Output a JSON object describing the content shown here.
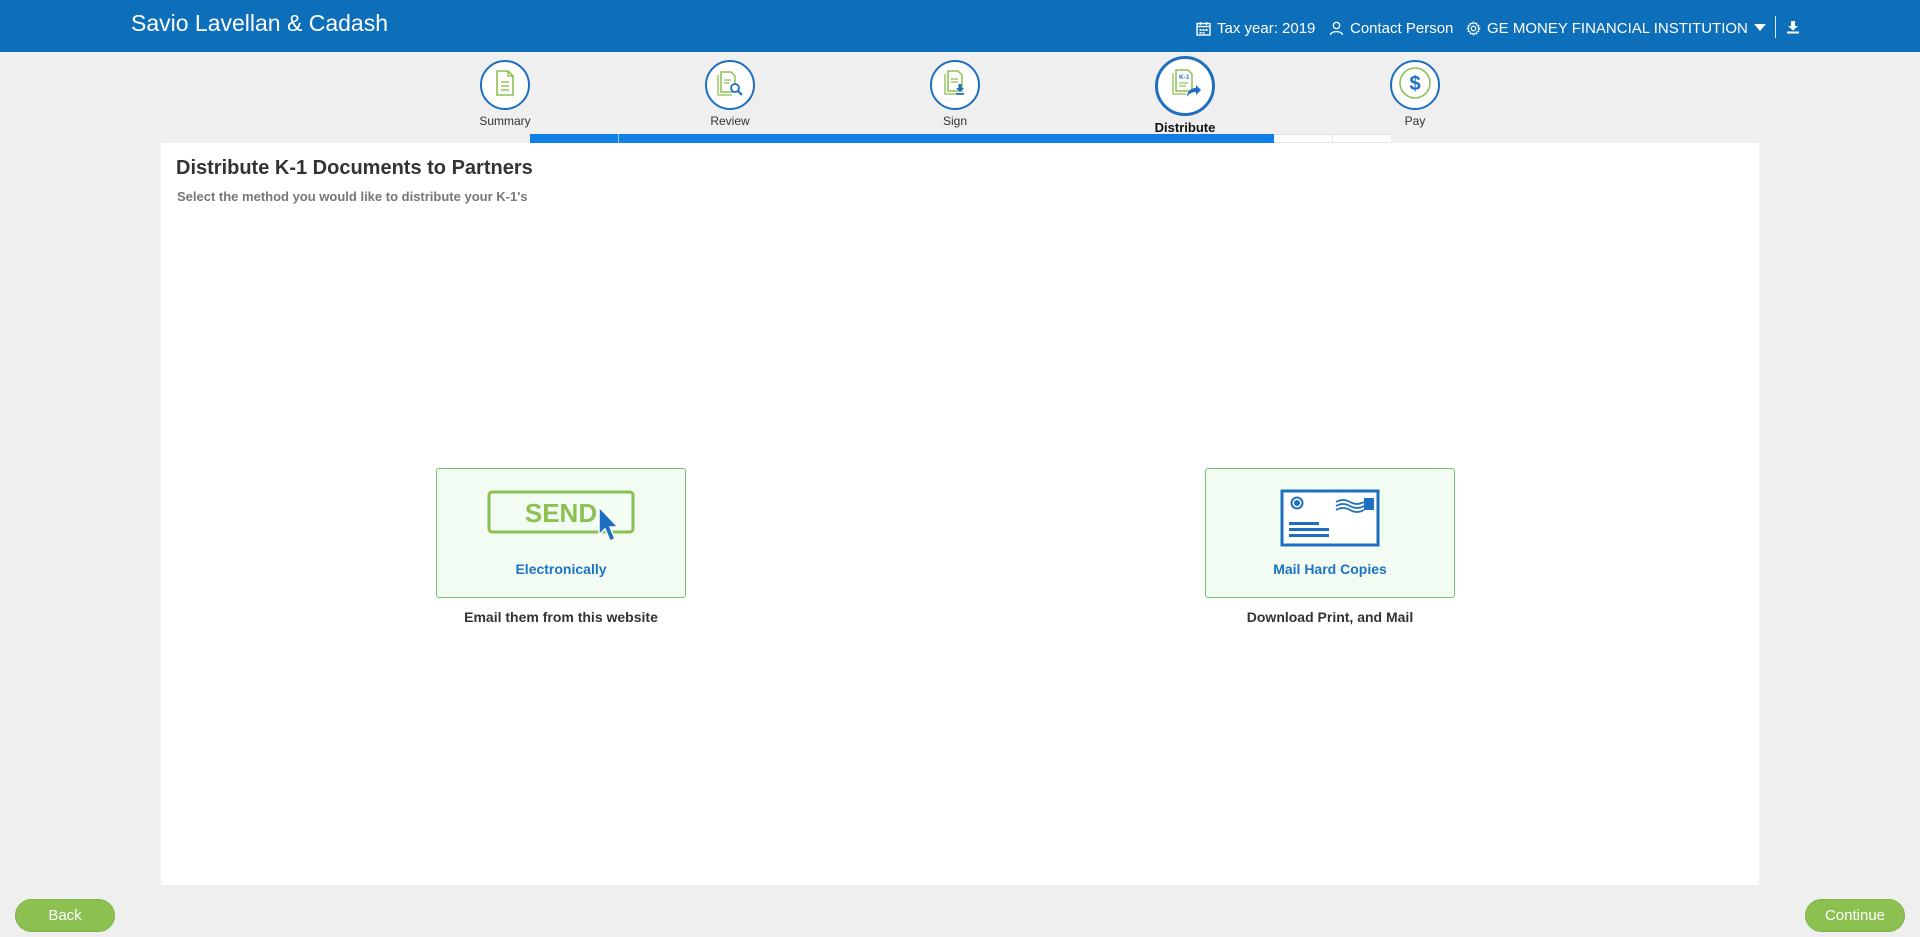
{
  "header": {
    "app_title": "Savio Lavellan & Cadash",
    "tax_year": "Tax year: 2019",
    "contact": "Contact Person",
    "institution": "GE MONEY FINANCIAL INSTITUTION"
  },
  "stepper": {
    "steps": [
      {
        "label": "Summary",
        "icon": "document-icon",
        "state": "done"
      },
      {
        "label": "Review",
        "icon": "document-search-icon",
        "state": "done"
      },
      {
        "label": "Sign",
        "icon": "document-download-icon",
        "state": "done"
      },
      {
        "label": "Distribute",
        "icon": "k1-share-icon",
        "state": "active"
      },
      {
        "label": "Pay",
        "icon": "dollar-icon",
        "state": "pending"
      }
    ]
  },
  "main": {
    "title": "Distribute K-1 Documents to Partners",
    "subtitle": "Select the method you would like to distribute your K-1's",
    "options": [
      {
        "label": "Electronically",
        "art_text": "SEND",
        "description": "Email them from this website",
        "icon": "send-button-cursor-icon"
      },
      {
        "label": "Mail Hard Copies",
        "description": "Download Print, and Mail",
        "icon": "envelope-icon"
      }
    ]
  },
  "footer": {
    "back_label": "Back",
    "continue_label": "Continue"
  },
  "colors": {
    "header_bg": "#0d6fba",
    "accent_blue": "#0f7fe6",
    "accent_green": "#8cc152",
    "option_border": "#76c276"
  }
}
